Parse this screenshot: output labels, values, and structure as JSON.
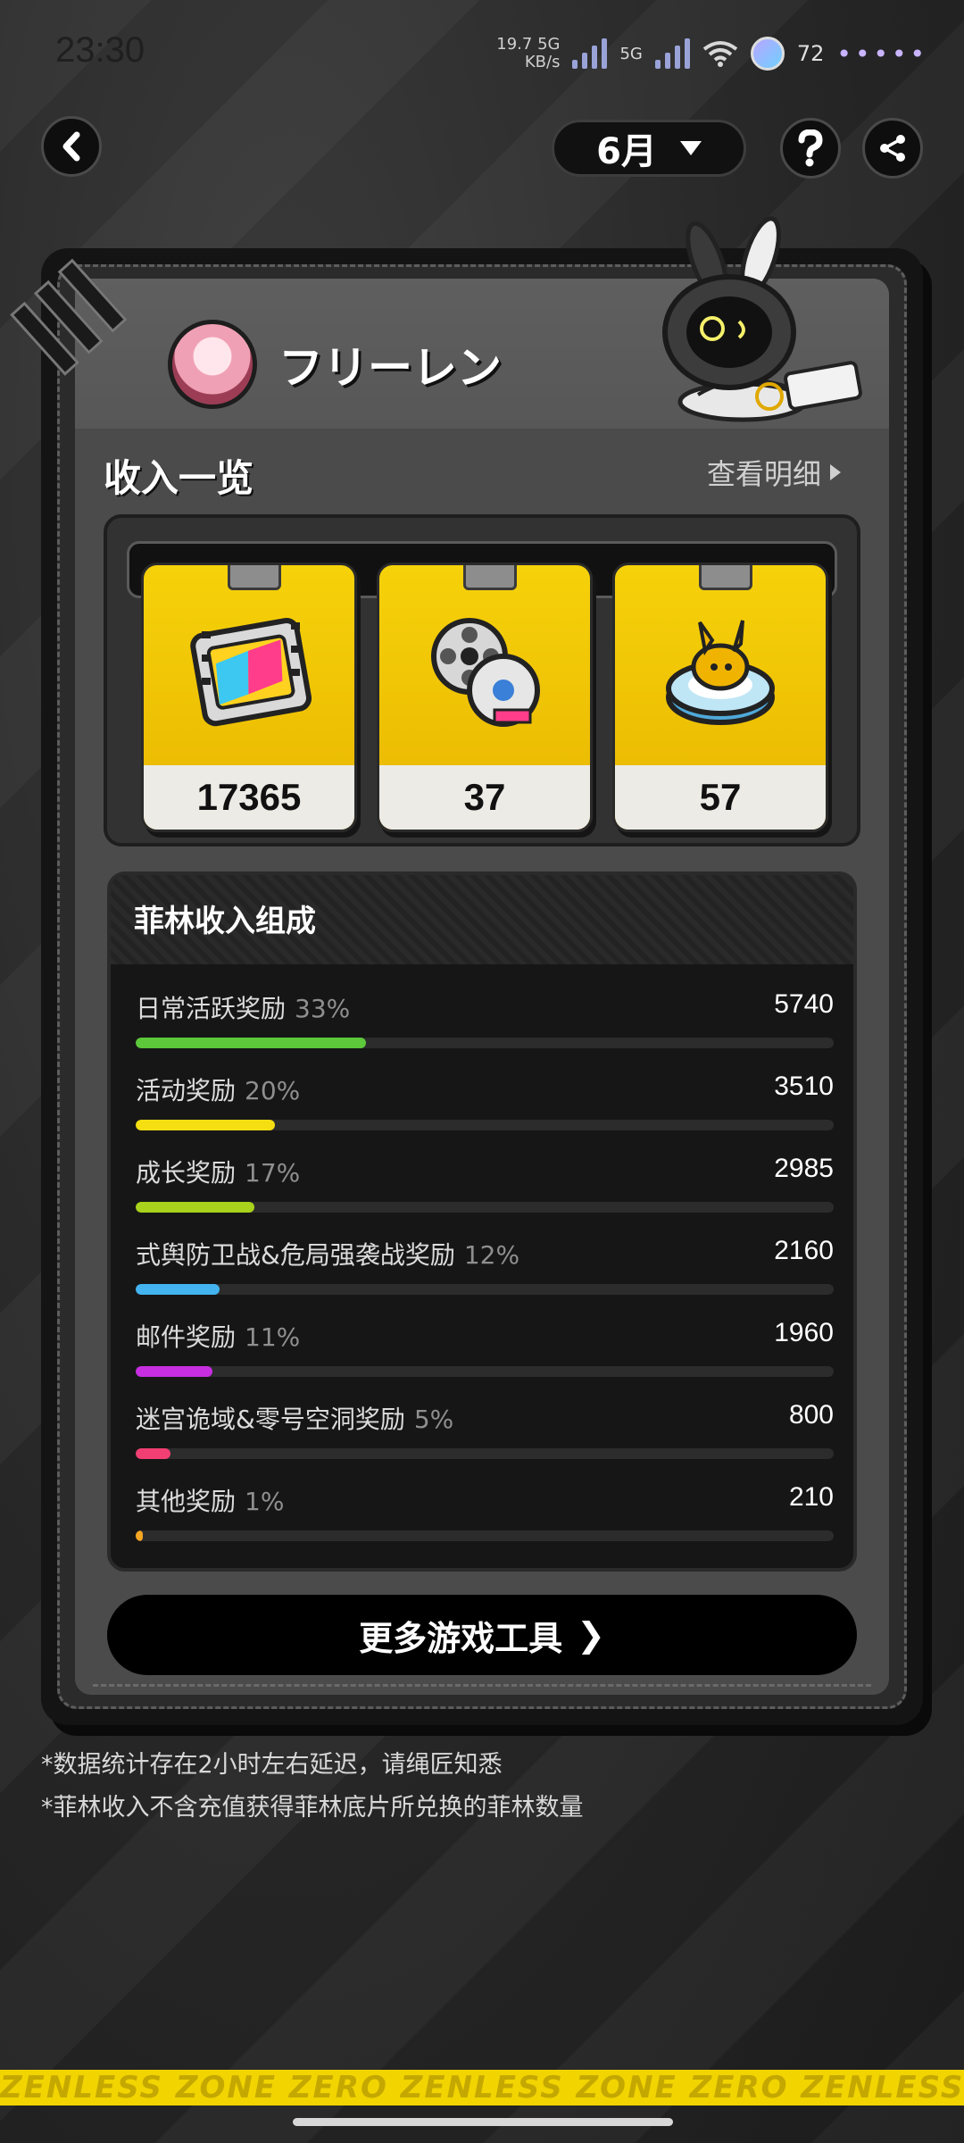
{
  "status_bar": {
    "time": "23:30",
    "net_speed_value": "19.7",
    "net_speed_unit": "KB/s",
    "signal_label_1": "5G",
    "signal_label_2": "5G",
    "battery_level": "72",
    "dots": "•••••"
  },
  "nav": {
    "month": "6月"
  },
  "profile": {
    "name": "フリーレン"
  },
  "income": {
    "title": "收入一览",
    "view_detail": "查看明细",
    "rewards": [
      {
        "icon": "film-ticket-icon",
        "count": "17365"
      },
      {
        "icon": "film-reel-icon",
        "count": "37"
      },
      {
        "icon": "bangboo-badge-icon",
        "count": "57"
      }
    ]
  },
  "breakdown": {
    "title": "菲林收入组成",
    "items": [
      {
        "label": "日常活跃奖励",
        "percent": "33%",
        "value": "5740",
        "fraction": 0.33,
        "color": "#5cc83a"
      },
      {
        "label": "活动奖励",
        "percent": "20%",
        "value": "3510",
        "fraction": 0.2,
        "color": "#f5df12"
      },
      {
        "label": "成长奖励",
        "percent": "17%",
        "value": "2985",
        "fraction": 0.17,
        "color": "#a8d21c"
      },
      {
        "label": "式舆防卫战&危局强袭战奖励",
        "percent": "12%",
        "value": "2160",
        "fraction": 0.12,
        "color": "#43b4f0"
      },
      {
        "label": "邮件奖励",
        "percent": "11%",
        "value": "1960",
        "fraction": 0.11,
        "color": "#c62ee0"
      },
      {
        "label": "迷宫诡域&零号空洞奖励",
        "percent": "5%",
        "value": "800",
        "fraction": 0.05,
        "color": "#f23f73"
      },
      {
        "label": "其他奖励",
        "percent": "1%",
        "value": "210",
        "fraction": 0.01,
        "color": "#f5a623"
      }
    ]
  },
  "more_tools": {
    "label": "更多游戏工具",
    "arrow": "❯"
  },
  "notes": [
    "*数据统计存在2小时左右延迟，请绳匠知悉",
    "*菲林收入不含充值获得菲林底片所兑换的菲林数量"
  ],
  "brand_strip_text": "ZENLESS ZONE ZERO ZENLESS ZONE ZERO ZENLESS ZONE ZERO ZENLESS ZONE ZERO"
}
